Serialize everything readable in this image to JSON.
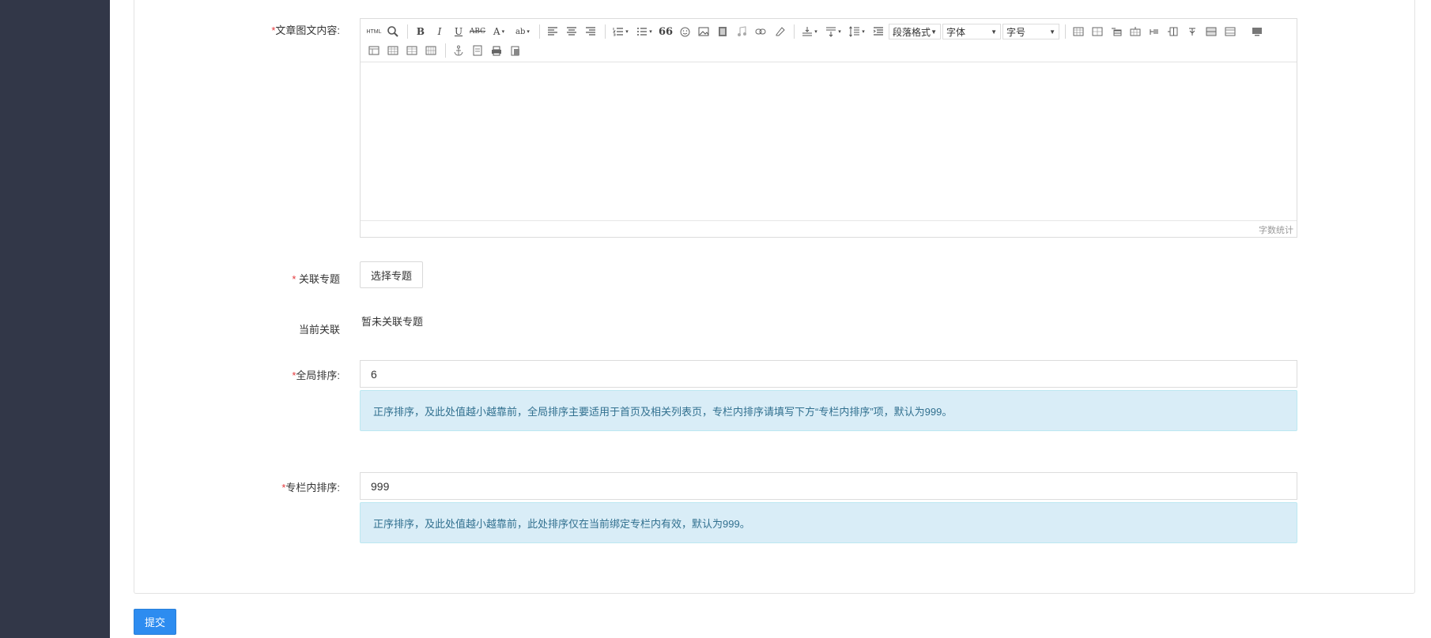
{
  "form": {
    "content_label": "文章图文内容:",
    "topic_label": "关联专题",
    "topic_button": "选择专题",
    "current_label": "当前关联",
    "current_value": "暂未关联专题",
    "global_sort_label": "全局排序:",
    "global_sort_value": "6",
    "global_sort_hint": "正序排序，及此处值越小越靠前，全局排序主要适用于首页及相关列表页，专栏内排序请填写下方“专栏内排序”项，默认为999。",
    "column_sort_label": "专栏内排序:",
    "column_sort_value": "999",
    "column_sort_hint": "正序排序，及此处值越小越靠前，此处排序仅在当前绑定专栏内有效，默认为999。",
    "submit": "提交"
  },
  "editor": {
    "html_button": "HTML",
    "paragraph_select": "段落格式",
    "font_select": "字体",
    "size_select": "字号",
    "word_count": "字数统计",
    "bold": "B",
    "italic": "I",
    "underline": "U",
    "strike": "ABC",
    "font_color": "A",
    "quote": "66"
  },
  "colors": {
    "sidebar": "#323748",
    "required": "#e4393c",
    "primary": "#2d8cf0",
    "alert_bg": "#d9edf7",
    "alert_text": "#31708f"
  }
}
